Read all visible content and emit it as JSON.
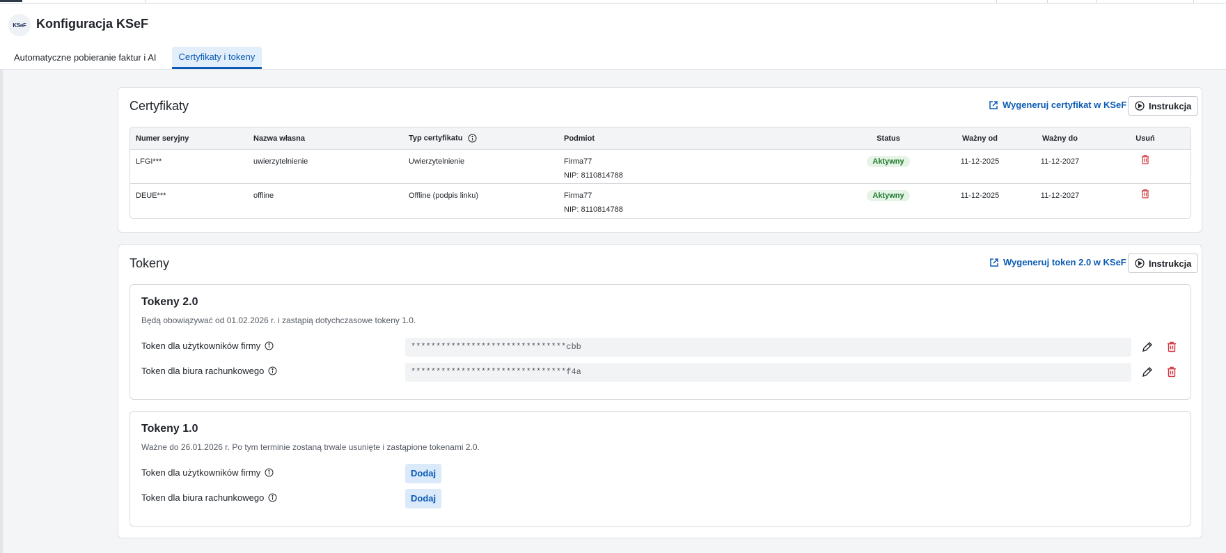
{
  "app": {
    "title": "Konfiguracja KSeF",
    "logo_text": "KSeF"
  },
  "tabs": [
    {
      "label": "Automatyczne pobieranie faktur i AI"
    },
    {
      "label": "Certyfikaty i tokeny",
      "active": true
    }
  ],
  "certificates": {
    "title": "Certyfikaty",
    "generate_link": "Wygeneruj certyfikat w KSeF",
    "instruction_button": "Instrukcja",
    "columns": {
      "serial": "Numer seryjny",
      "own_name": "Nazwa własna",
      "type": "Typ certyfikatu",
      "entity": "Podmiot",
      "status": "Status",
      "valid_from": "Ważny od",
      "valid_to": "Ważny do",
      "delete": "Usuń"
    },
    "rows": [
      {
        "serial": "LFGI***",
        "own_name": "uwierzytelnienie",
        "type": "Uwierzytelnienie",
        "entity_name": "Firma77",
        "entity_nip": "NIP: 8110814788",
        "status": "Aktywny",
        "valid_from": "11-12-2025",
        "valid_to": "11-12-2027"
      },
      {
        "serial": "DEUE***",
        "own_name": "offline",
        "type": "Offline (podpis linku)",
        "entity_name": "Firma77",
        "entity_nip": "NIP: 8110814788",
        "status": "Aktywny",
        "valid_from": "11-12-2025",
        "valid_to": "11-12-2027"
      }
    ]
  },
  "tokens": {
    "title": "Tokeny",
    "generate_link": "Wygeneruj token 2.0 w KSeF",
    "instruction_button": "Instrukcja",
    "v2": {
      "title": "Tokeny 2.0",
      "description": "Będą obowiązywać od 01.02.2026 r. i zastąpią dotychczasowe tokeny 1.0.",
      "rows": [
        {
          "label": "Token dla użytkowników firmy",
          "value": "*******************************cbb"
        },
        {
          "label": "Token dla biura rachunkowego",
          "value": "*******************************f4a"
        }
      ]
    },
    "v1": {
      "title": "Tokeny 1.0",
      "description": "Ważne do 26.01.2026 r. Po tym terminie zostaną trwale usunięte i zastąpione tokenami 2.0.",
      "rows": [
        {
          "label": "Token dla użytkowników firmy",
          "button": "Dodaj"
        },
        {
          "label": "Token dla biura rachunkowego",
          "button": "Dodaj"
        }
      ]
    }
  },
  "colors": {
    "accent": "#0b5bb5",
    "danger": "#d1333b",
    "active_badge_bg": "#e5f4e6",
    "active_badge_text": "#1d7a2c"
  }
}
